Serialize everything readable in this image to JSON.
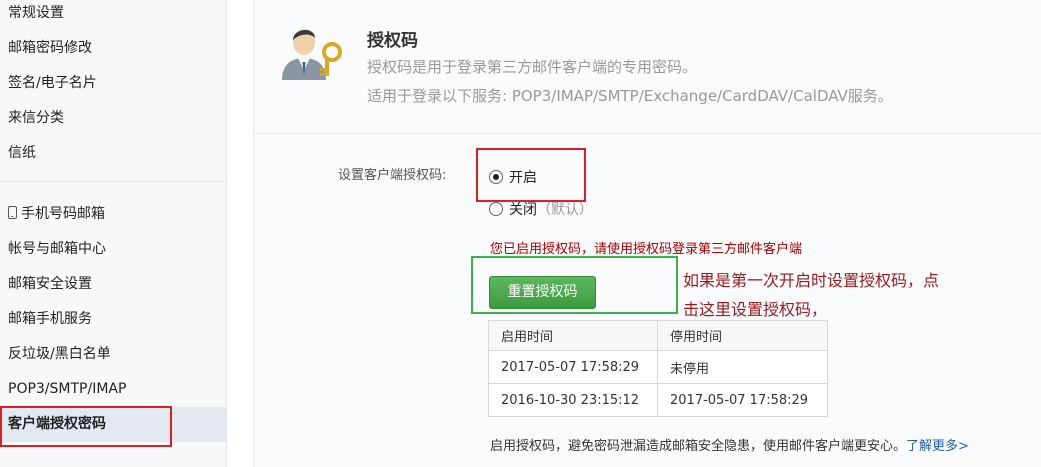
{
  "sidebar": {
    "items": [
      {
        "label": "常规设置"
      },
      {
        "label": "邮箱密码修改"
      },
      {
        "label": "签名/电子名片"
      },
      {
        "label": "来信分类"
      },
      {
        "label": "信纸"
      },
      {
        "label": "手机号码邮箱",
        "icon": "phone-icon"
      },
      {
        "label": "帐号与邮箱中心"
      },
      {
        "label": "邮箱安全设置"
      },
      {
        "label": "邮箱手机服务"
      },
      {
        "label": "反垃圾/黑白名单"
      },
      {
        "label": "POP3/SMTP/IMAP"
      },
      {
        "label": "客户端授权密码",
        "active": true
      }
    ]
  },
  "header": {
    "icon": "user-key-icon",
    "title": "授权码",
    "desc1": "授权码是用于登录第三方邮件客户端的专用密码。",
    "desc2": "适用于登录以下服务: POP3/IMAP/SMTP/Exchange/CardDAV/CalDAV服务。"
  },
  "settings": {
    "label": "设置客户端授权码:",
    "option_on": "开启",
    "option_off": "关闭",
    "option_off_note": "（默认）",
    "selected": "开启",
    "status_message": "您已启用授权码，请使用授权码登录第三方邮件客户端",
    "reset_button": "重置授权码"
  },
  "annotation": {
    "line1": "如果是第一次开启时设置授权码，点",
    "line2": "击这里设置授权码，"
  },
  "log_table": {
    "headers": [
      "启用时间",
      "停用时间"
    ],
    "rows": [
      [
        "2017-05-07 17:58:29",
        "未停用"
      ],
      [
        "2016-10-30 23:15:12",
        "2017-05-07 17:58:29"
      ]
    ]
  },
  "footer": {
    "text": "启用授权码，避免密码泄漏造成邮箱安全隐患，使用邮件客户端更安心。",
    "link": "了解更多>"
  },
  "colors": {
    "highlight_red": "#e02020",
    "highlight_green": "#3cb04a",
    "button_green": "#4aa84a",
    "status_red": "#b00000",
    "link_blue": "#1f5fbf"
  }
}
